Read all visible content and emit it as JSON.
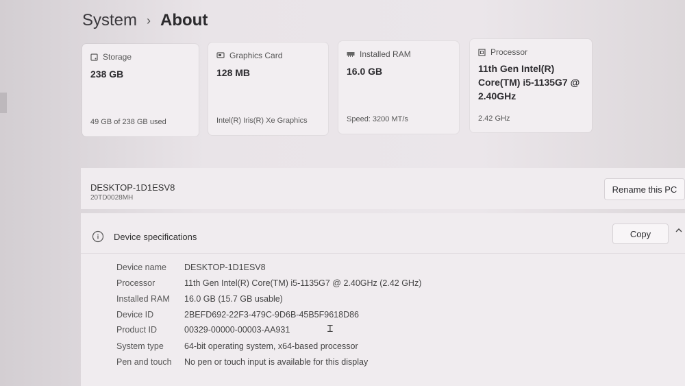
{
  "breadcrumb": {
    "parent": "System",
    "separator": "›",
    "current": "About"
  },
  "cards": [
    {
      "icon": "storage-icon",
      "title": "Storage",
      "value": "238 GB",
      "sub": "49 GB of 238 GB used"
    },
    {
      "icon": "graphics-card-icon",
      "title": "Graphics Card",
      "value": "128 MB",
      "sub": "Intel(R) Iris(R) Xe Graphics"
    },
    {
      "icon": "ram-icon",
      "title": "Installed RAM",
      "value": "16.0 GB",
      "sub": "Speed: 3200 MT/s"
    },
    {
      "icon": "processor-icon",
      "title": "Processor",
      "value_lines": [
        "11th Gen Intel(R)",
        "Core(TM) i5-1135G7 @",
        "2.40GHz"
      ],
      "sub": "2.42 GHz"
    }
  ],
  "pc": {
    "name": "DESKTOP-1D1ESV8",
    "model": "20TD0028MH",
    "rename_label": "Rename this PC"
  },
  "specs": {
    "title": "Device specifications",
    "copy_label": "Copy",
    "rows": [
      {
        "label": "Device name",
        "value": "DESKTOP-1D1ESV8"
      },
      {
        "label": "Processor",
        "value": "11th Gen Intel(R) Core(TM) i5-1135G7 @ 2.40GHz (2.42 GHz)"
      },
      {
        "label": "Installed RAM",
        "value": "16.0 GB (15.7 GB usable)"
      },
      {
        "label": "Device ID",
        "value": "2BEFD692-22F3-479C-9D6B-45B5F9618D86"
      },
      {
        "label": "Product ID",
        "value": "00329-00000-00003-AA931"
      },
      {
        "label": "System type",
        "value": "64-bit operating system, x64-based processor"
      },
      {
        "label": "Pen and touch",
        "value": "No pen or touch input is available for this display"
      }
    ]
  }
}
